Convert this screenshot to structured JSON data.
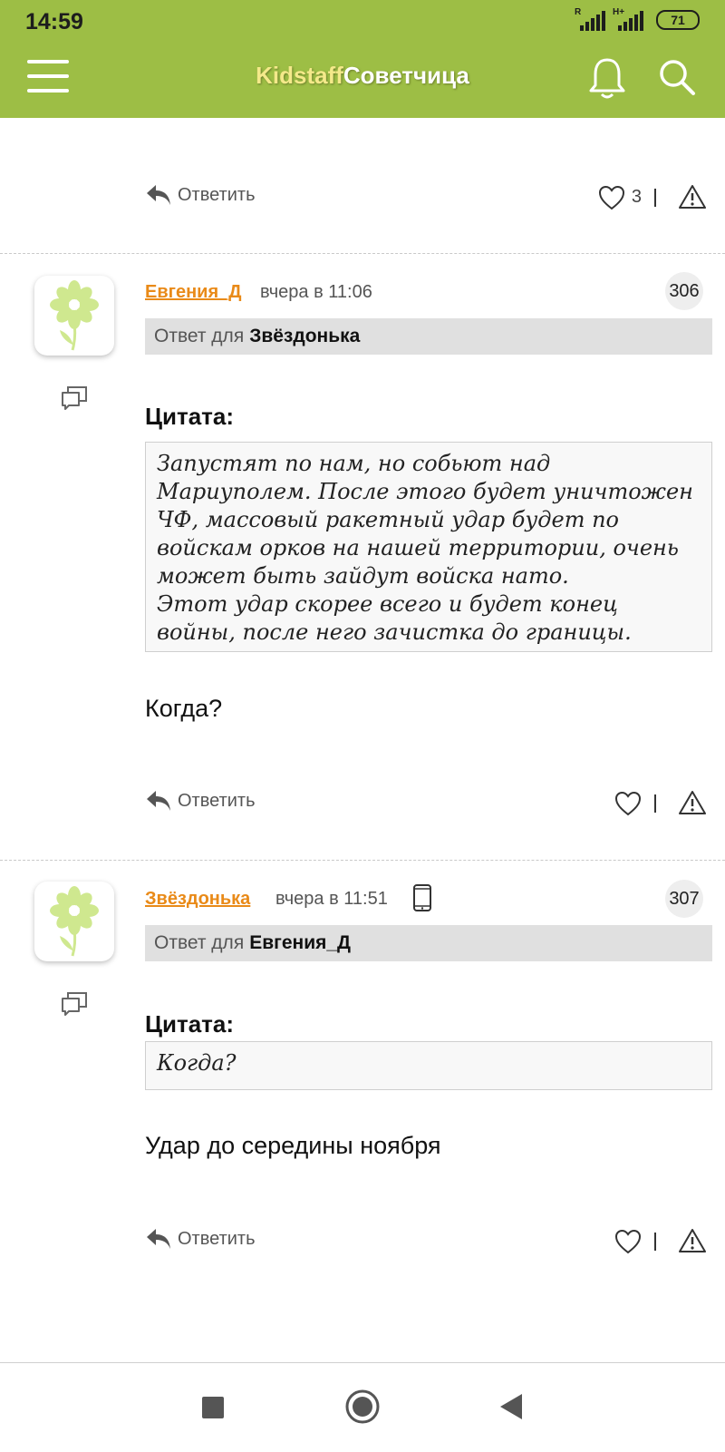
{
  "status": {
    "time": "14:59",
    "signal1_label": "R",
    "signal2_label": "H+",
    "battery": "71"
  },
  "header": {
    "brand_part1": "Kidstaff",
    "brand_part2": "Советчица"
  },
  "top_actions": {
    "reply_label": "Ответить",
    "likes": "3"
  },
  "posts": [
    {
      "author": "Евгения_Д",
      "time": "вчера в 11:06",
      "number": "306",
      "reply_prefix": "Ответ для",
      "reply_to": "Звёздонька",
      "quote_label": "Цитата:",
      "quote": "Запустят по нам, но собьют над\nМариуполем. После этого будет уничтожен\nЧФ, массовый ракетный удар будет по\nвойскам орков на нашей территории, очень\nможет быть зайдут войска нато.\nЭтот удар скорее всего и будет конец\nвойны, после него зачистка до границы.",
      "text": "Когда?",
      "reply_label": "Ответить"
    },
    {
      "author": "Звёздонька",
      "time": "вчера в 11:51",
      "number": "307",
      "reply_prefix": "Ответ для",
      "reply_to": "Евгения_Д",
      "quote_label": "Цитата:",
      "quote": "Когда?",
      "text": "Удар до середины ноября",
      "reply_label": "Ответить"
    }
  ],
  "colors": {
    "header": "#9dbe45",
    "author": "#e98a18",
    "reply_bar": "#e0e0e0"
  }
}
